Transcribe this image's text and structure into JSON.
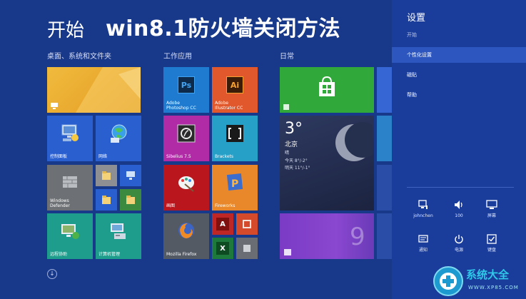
{
  "start": {
    "title": "开始"
  },
  "overlay": {
    "title": "win8.1防火墙关闭方法"
  },
  "groups": [
    {
      "label": "桌面、系统和文件夹"
    },
    {
      "label": "工作应用"
    },
    {
      "label": "日常"
    }
  ],
  "tiles": {
    "control_panel": "控制面板",
    "network": "网络",
    "defender_line1": "Windows",
    "defender_line2": "Defender",
    "remote": "远程协助",
    "computer_admin": "计算机管理",
    "photoshop_line1": "Adobe",
    "photoshop_line2": "Photoshop CC",
    "photoshop_abbr": "Ps",
    "illustrator_line1": "Adobe",
    "illustrator_line2": "Illustrator CC",
    "illustrator_abbr": "Ai",
    "sibelius": "Sibelius 7.5",
    "brackets": "Brackets",
    "paint": "画图",
    "fireworks": "Fireworks",
    "firefox": "Mozilla Firefox",
    "access_letter": "A",
    "excel_letter": "X",
    "weather_temp": "3°",
    "weather_city": "北京",
    "weather_cond": "晴",
    "weather_line1": "今天 8°/-2°",
    "weather_line2": "明天 11°/-1°"
  },
  "charm": {
    "title": "设置",
    "subtitle": "开始",
    "items": [
      {
        "label": "个性化设置"
      },
      {
        "label": "磁贴"
      },
      {
        "label": "帮助"
      }
    ],
    "quick": [
      {
        "label": "johnchen"
      },
      {
        "label": "100"
      },
      {
        "label": "屏幕"
      },
      {
        "label": "通知"
      },
      {
        "label": "电源"
      },
      {
        "label": "键盘"
      }
    ]
  },
  "watermark": {
    "text": "系统大全",
    "url": "WWW.XP85.COM"
  },
  "colors": {
    "background": "#18388a",
    "charm": "#1a3d9c",
    "desktop_tile": "#e8a92c",
    "store_tile": "#31a83a",
    "weather_tile": "#232c4a",
    "photoshop": "#1f7bd0",
    "illustrator": "#e0582c",
    "sibelius": "#b12ba7",
    "paint": "#b9161e",
    "fireworks": "#e8882a",
    "access": "#bf2626",
    "excel": "#1e7a3c"
  }
}
